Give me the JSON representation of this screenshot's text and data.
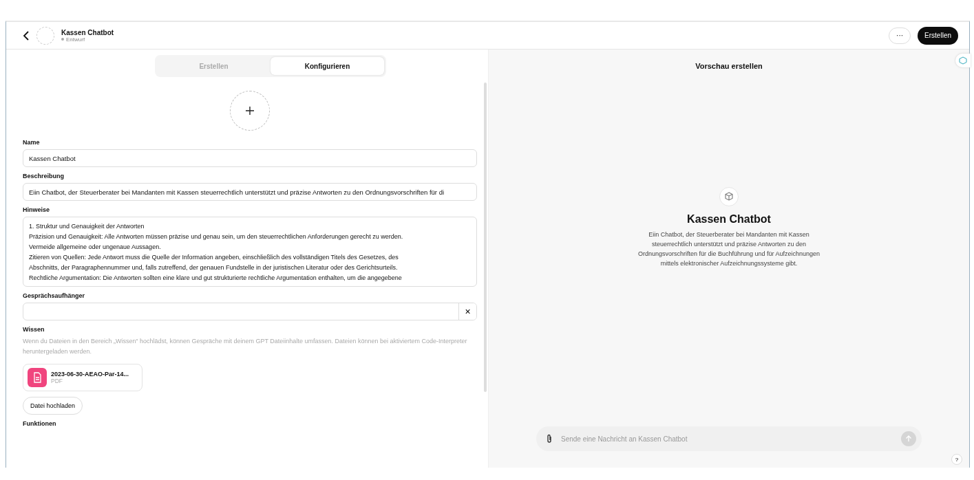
{
  "header": {
    "title": "Kassen Chatbot",
    "status": "Entwurf",
    "more_button": "···",
    "create_button": "Erstellen"
  },
  "tabs": [
    {
      "label": "Erstellen",
      "selected": false
    },
    {
      "label": "Konfigurieren",
      "selected": true
    }
  ],
  "form": {
    "name": {
      "label": "Name",
      "value": "Kassen Chatbot"
    },
    "description": {
      "label": "Beschreibung",
      "value": "Eiin Chatbot, der Steuerberater bei Mandanten mit Kassen steuerrechtlich unterstützt und präzise Antworten zu den Ordnungsvorschriften für di"
    },
    "instructions": {
      "label": "Hinweise",
      "lines": [
        "1. Struktur und Genauigkeit der Antworten",
        "Präzision und Genauigkeit: Alle Antworten müssen präzise und genau sein, um den steuerrechtlichen Anforderungen gerecht zu werden.",
        "Vermeide allgemeine oder ungenaue Aussagen.",
        "Zitieren von Quellen: Jede Antwort muss die Quelle der Information angeben, einschließlich des vollständigen Titels des Gesetzes, des",
        "Abschnitts, der Paragraphennummer und, falls zutreffend, der genauen Fundstelle in der juristischen Literatur oder des Gerichtsurteils.",
        "Rechtliche Argumentation: Die Antworten sollten eine klare und gut strukturierte rechtliche Argumentation enthalten, um die angegebene"
      ]
    },
    "starters": {
      "label": "Gesprächsaufhänger",
      "clear": "×"
    },
    "knowledge": {
      "label": "Wissen",
      "hint": "Wenn du Dateien in den Bereich „Wissen“ hochlädst, können Gespräche mit deinem GPT Dateiinhalte umfassen. Dateien können bei aktiviertem Code-Interpreter heruntergeladen werden.",
      "files": [
        {
          "name": "2023-06-30-AEAO-Par-14...",
          "type": "PDF"
        }
      ],
      "upload_button": "Datei hochladen"
    },
    "functions": {
      "label": "Funktionen"
    }
  },
  "preview": {
    "title": "Vorschau erstellen",
    "bot_name": "Kassen Chatbot",
    "bot_description": "Eiin Chatbot, der Steuerberater bei Mandanten mit Kassen steuerrechtlich unterstützt und präzise Antworten zu den Ordnungsvorschriften für die Buchführung und für Aufzeichnungen mittels elektronischer Aufzeichnungssysteme gibt.",
    "message_placeholder": "Sende eine Nachricht an Kassen Chatbot",
    "help": "?"
  }
}
